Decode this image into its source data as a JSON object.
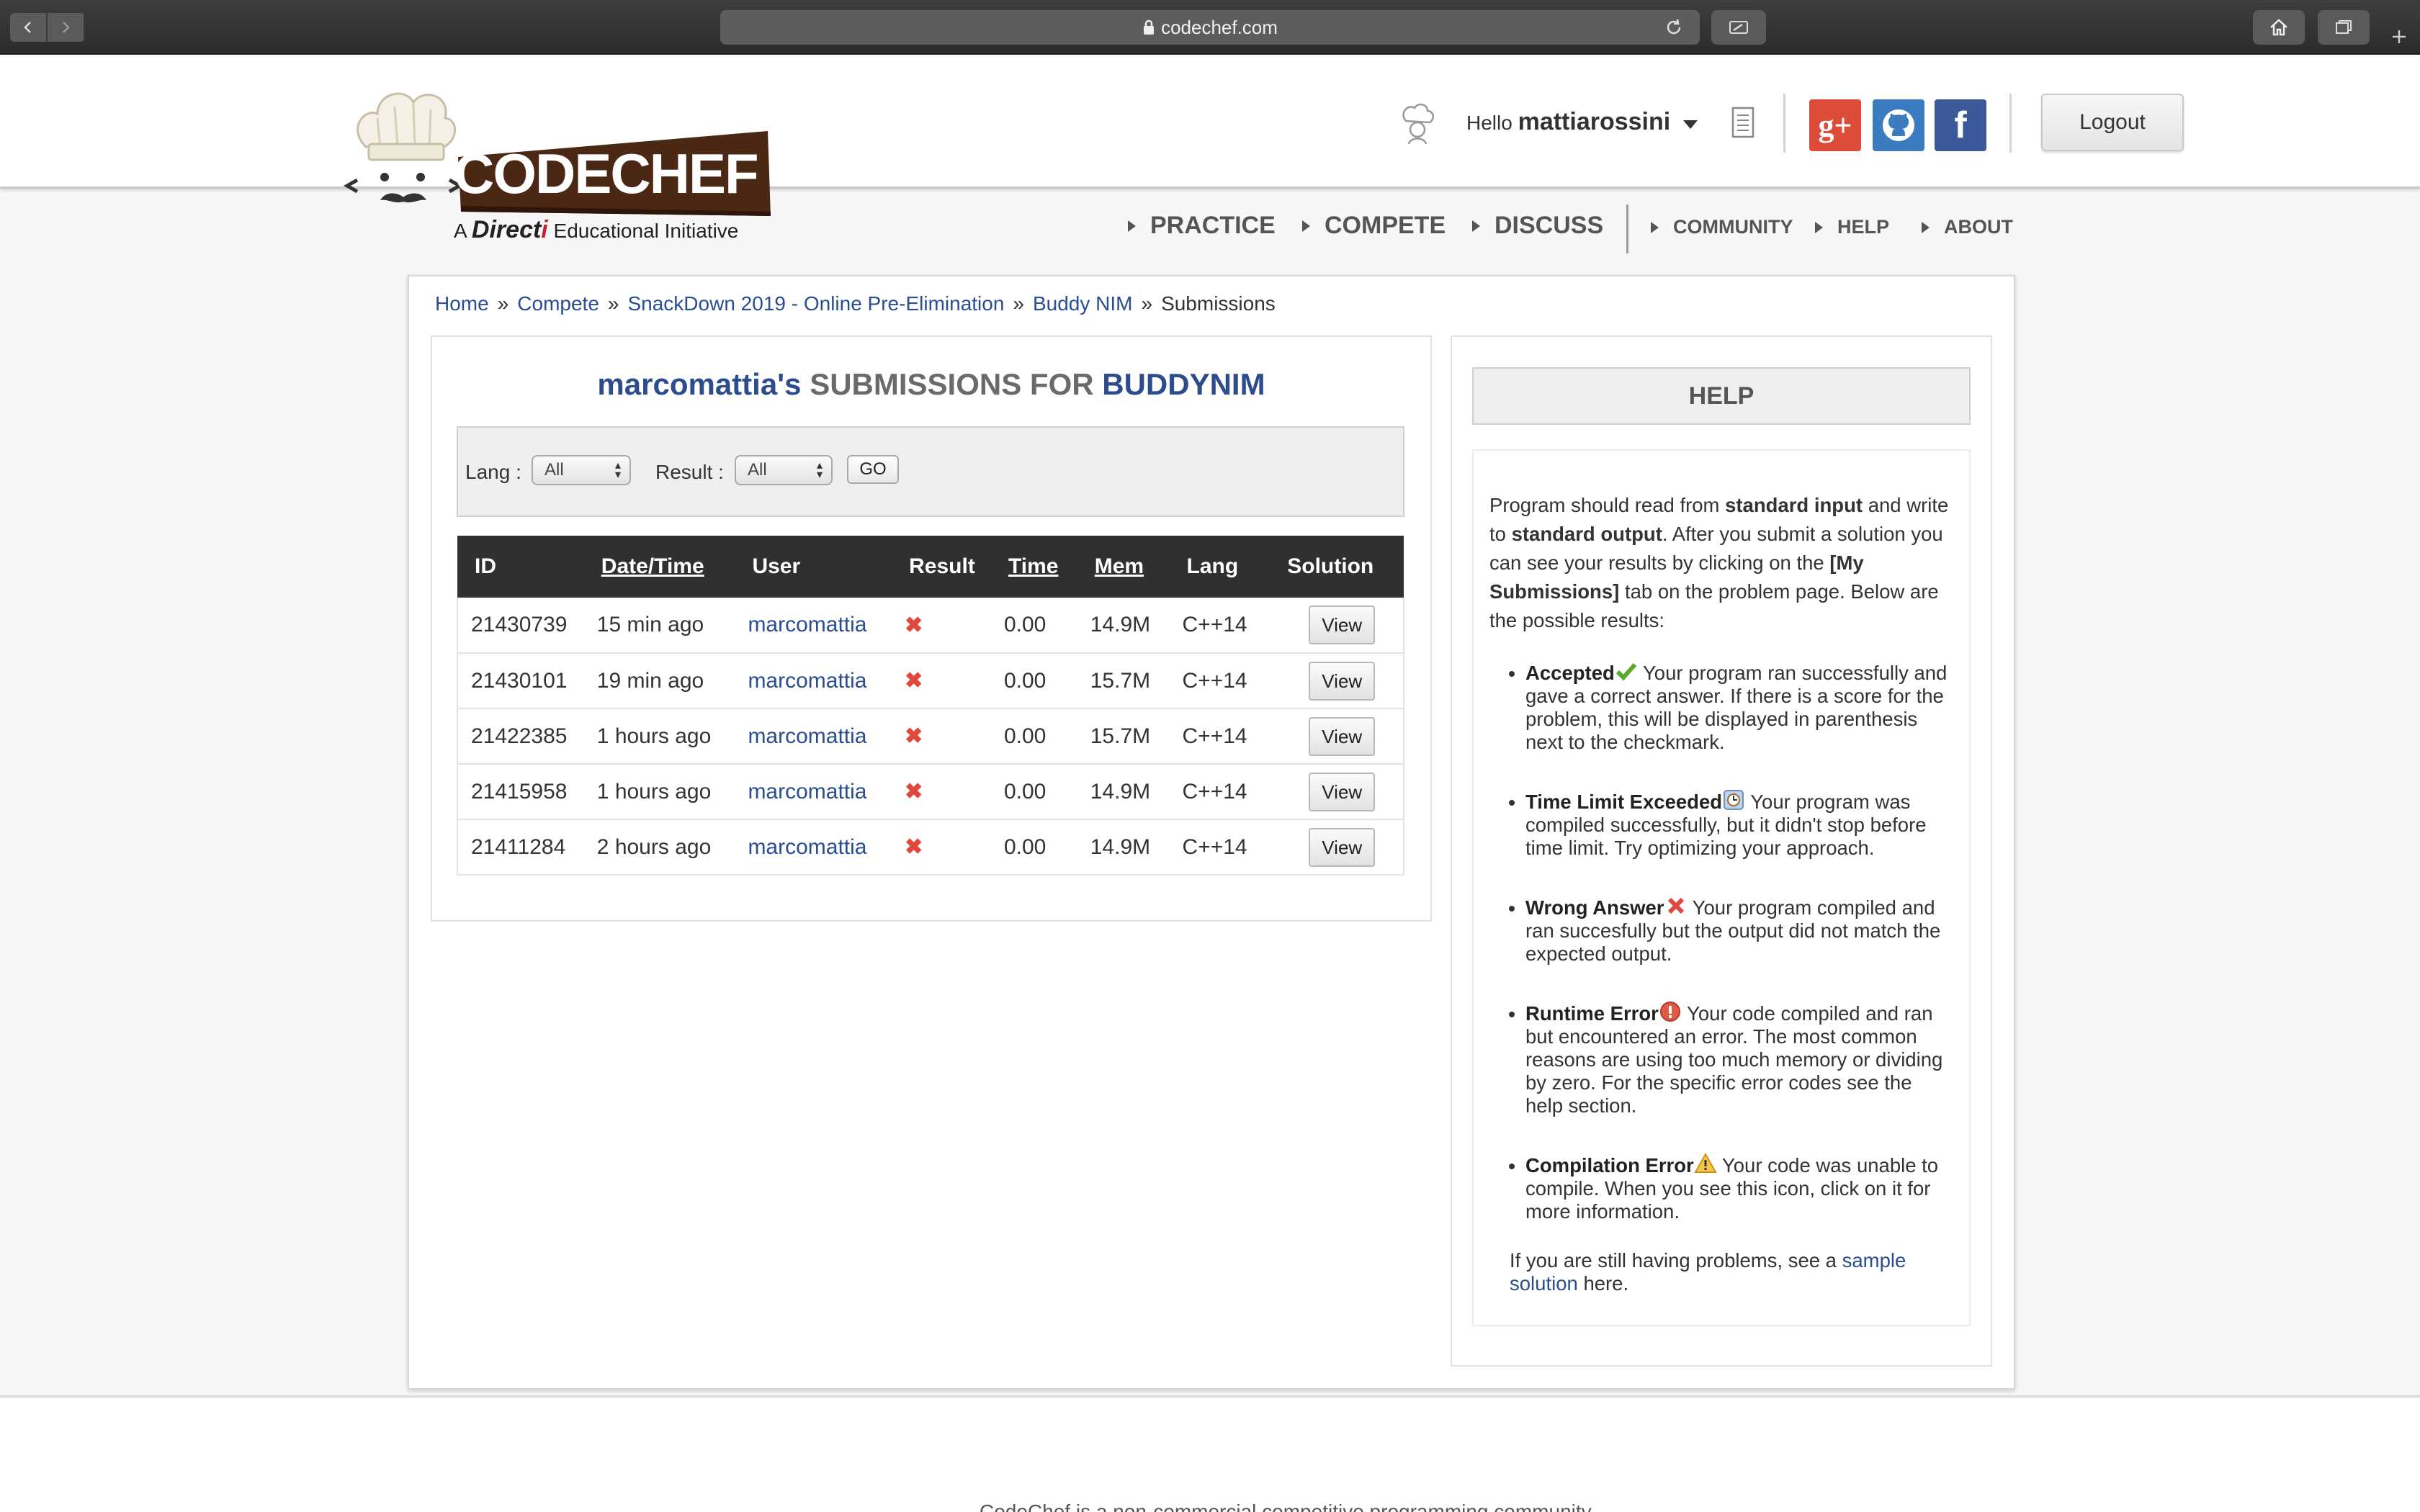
{
  "browser": {
    "url": "codechef.com",
    "icons": [
      "back-icon",
      "forward-icon",
      "lock-icon",
      "reload-icon",
      "sidebar-icon",
      "home-icon",
      "tabs-icon",
      "new-tab-icon"
    ]
  },
  "header": {
    "logo_text": "CODECHEF",
    "tagline_a": "A",
    "tagline_brand_main": "Direct",
    "tagline_brand_end": "i",
    "tagline_rest": "Educational Initiative",
    "hello": "Hello",
    "username": "mattiarossini",
    "logout": "Logout",
    "social": [
      "g+",
      "github",
      "f"
    ],
    "nav_primary": [
      "PRACTICE",
      "COMPETE",
      "DISCUSS"
    ],
    "nav_secondary": [
      "COMMUNITY",
      "HELP",
      "ABOUT"
    ]
  },
  "breadcrumb": [
    "Home",
    "Compete",
    "SnackDown 2019 - Online Pre-Elimination",
    "Buddy NIM",
    "Submissions"
  ],
  "breadcrumb_sep": "»",
  "submissions": {
    "title_user": "marcomattia's",
    "title_mid": "SUBMISSIONS FOR",
    "title_problem": "BUDDYNIM",
    "filters": {
      "lang_label": "Lang :",
      "lang_value": "All",
      "result_label": "Result :",
      "result_value": "All",
      "go": "GO"
    },
    "columns": [
      "ID",
      "Date/Time",
      "User",
      "Result",
      "Time",
      "Mem",
      "Lang",
      "Solution"
    ],
    "rows": [
      {
        "id": "21430739",
        "date": "15 min ago",
        "user": "marcomattia",
        "result": "✖",
        "time": "0.00",
        "mem": "14.9M",
        "lang": "C++14",
        "solution": "View"
      },
      {
        "id": "21430101",
        "date": "19 min ago",
        "user": "marcomattia",
        "result": "✖",
        "time": "0.00",
        "mem": "15.7M",
        "lang": "C++14",
        "solution": "View"
      },
      {
        "id": "21422385",
        "date": "1 hours ago",
        "user": "marcomattia",
        "result": "✖",
        "time": "0.00",
        "mem": "15.7M",
        "lang": "C++14",
        "solution": "View"
      },
      {
        "id": "21415958",
        "date": "1 hours ago",
        "user": "marcomattia",
        "result": "✖",
        "time": "0.00",
        "mem": "14.9M",
        "lang": "C++14",
        "solution": "View"
      },
      {
        "id": "21411284",
        "date": "2 hours ago",
        "user": "marcomattia",
        "result": "✖",
        "time": "0.00",
        "mem": "14.9M",
        "lang": "C++14",
        "solution": "View"
      }
    ]
  },
  "help": {
    "title": "HELP",
    "intro_1": "Program should read from",
    "intro_b1": "standard input",
    "intro_2": "and write to",
    "intro_b2": "standard output",
    "intro_3": ". After you submit a solution you can see your results by clicking on the",
    "intro_b3": "[My Submissions]",
    "intro_4": "tab on the problem page. Below are the possible results:",
    "items": [
      {
        "name": "Accepted",
        "icon": "check-icon",
        "text": "Your program ran successfully and gave a correct answer. If there is a score for the problem, this will be displayed in parenthesis next to the checkmark."
      },
      {
        "name": "Time Limit Exceeded",
        "icon": "clock-icon",
        "text": "Your program was compiled successfully, but it didn't stop before time limit. Try optimizing your approach."
      },
      {
        "name": "Wrong Answer",
        "icon": "cross-icon",
        "text": "Your program compiled and ran succesfully but the output did not match the expected output."
      },
      {
        "name": "Runtime Error",
        "icon": "error-icon",
        "text": "Your code compiled and ran but encountered an error. The most common reasons are using too much memory or dividing by zero. For the specific error codes see the help section."
      },
      {
        "name": "Compilation Error",
        "icon": "warning-icon",
        "text": "Your code was unable to compile. When you see this icon, click on it for more information."
      }
    ],
    "footer_1": "If you are still having problems, see a",
    "footer_link": "sample solution",
    "footer_2": "here."
  },
  "footer": {
    "text": "CodeChef is a non-commercial competitive programming community"
  }
}
